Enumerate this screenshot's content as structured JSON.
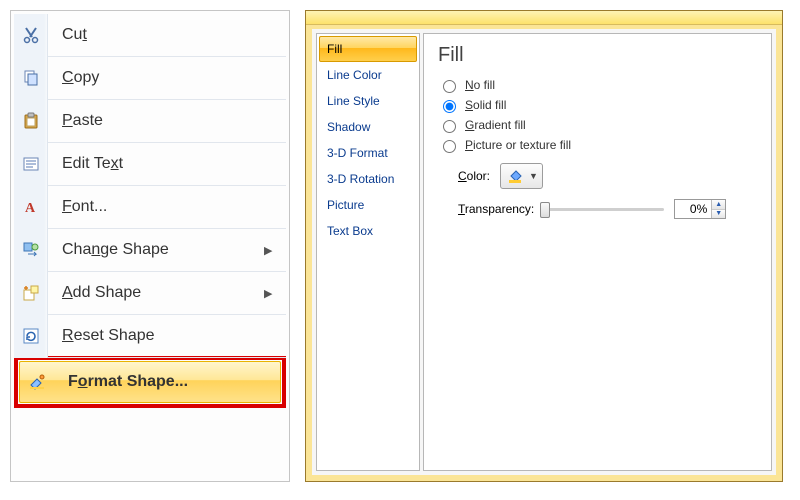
{
  "context_menu": {
    "items": [
      {
        "label_html": "Cu<u>t</u>",
        "icon": "cut"
      },
      {
        "label_html": "<u>C</u>opy",
        "icon": "copy"
      },
      {
        "label_html": "<u>P</u>aste",
        "icon": "paste"
      },
      {
        "label_html": "Edit Te<u>x</u>t",
        "icon": "edit-text"
      },
      {
        "label_html": "<u>F</u>ont...",
        "icon": "font"
      },
      {
        "label_html": "Cha<u>n</u>ge Shape",
        "icon": "change-shape",
        "submenu": true
      },
      {
        "label_html": "<u>A</u>dd Shape",
        "icon": "add-shape",
        "submenu": true
      },
      {
        "label_html": "<u>R</u>eset Shape",
        "icon": "reset-shape"
      },
      {
        "label_html": "F<u>o</u>rmat Shape...",
        "icon": "format-shape",
        "highlighted": true
      }
    ]
  },
  "dialog": {
    "nav": [
      {
        "label": "Fill",
        "selected": true
      },
      {
        "label": "Line Color"
      },
      {
        "label": "Line Style"
      },
      {
        "label": "Shadow"
      },
      {
        "label": "3-D Format"
      },
      {
        "label": "3-D Rotation"
      },
      {
        "label": "Picture"
      },
      {
        "label": "Text Box"
      }
    ],
    "pane": {
      "title": "Fill",
      "options": [
        {
          "label_html": "<u>N</u>o fill",
          "checked": false
        },
        {
          "label_html": "<u>S</u>olid fill",
          "checked": true
        },
        {
          "label_html": "<u>G</u>radient fill",
          "checked": false
        },
        {
          "label_html": "<u>P</u>icture or texture fill",
          "checked": false
        }
      ],
      "color_label_html": "<u>C</u>olor:",
      "transparency_label_html": "<u>T</u>ransparency:",
      "transparency_value": "0%"
    }
  }
}
